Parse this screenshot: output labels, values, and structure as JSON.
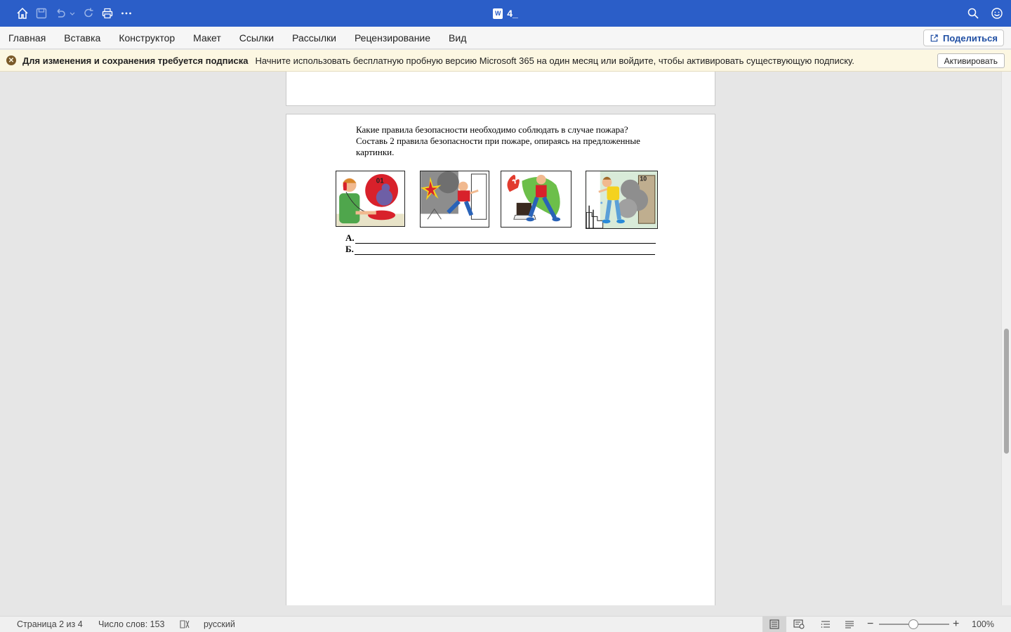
{
  "window": {
    "doc_title": "4_",
    "doc_badge": "W"
  },
  "ribbon": {
    "tabs": [
      "Главная",
      "Вставка",
      "Конструктор",
      "Макет",
      "Ссылки",
      "Рассылки",
      "Рецензирование",
      "Вид"
    ],
    "share_label": "Поделиться"
  },
  "notice": {
    "title": "Для изменения и сохранения требуется подписка",
    "message": "Начните использовать бесплатную пробную версию Microsoft 365 на один месяц или войдите, чтобы активировать существующую подписку.",
    "button": "Активировать"
  },
  "document": {
    "question_line1": "Какие правила безопасности необходимо соблюдать в случае пожара?",
    "question_line2": "Составь 2 правила безопасности при пожаре, опираясь на предложенные",
    "question_line3": "картинки.",
    "answer_a": "А.",
    "answer_b": "Б.",
    "picture_labels": {
      "phone_number": "01",
      "floor_number": "10"
    }
  },
  "status": {
    "page": "Страница 2 из 4",
    "words": "Число слов: 153",
    "language": "русский",
    "zoom": "100%"
  },
  "colors": {
    "titlebar": "#2b5ec8",
    "notice_bg": "#fcf7e2",
    "accent_text": "#1f4ea3"
  }
}
